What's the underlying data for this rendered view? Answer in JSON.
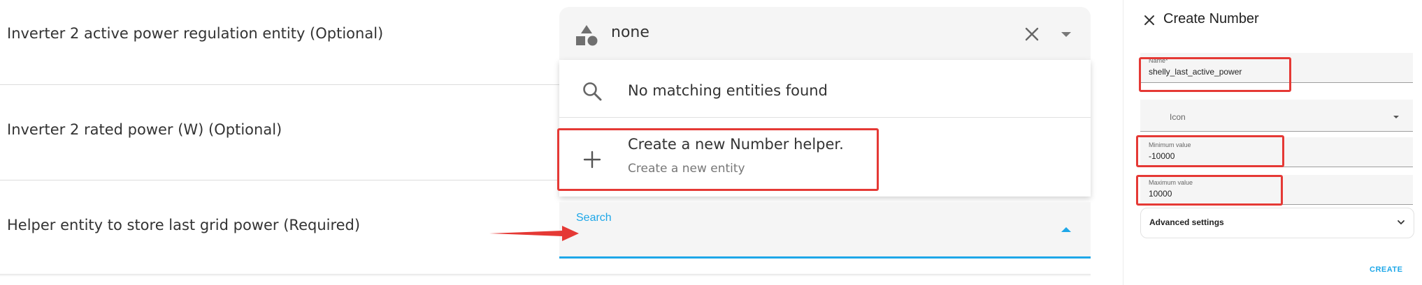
{
  "form": {
    "rows": [
      {
        "label": "Inverter 2 active power regulation entity (Optional)"
      },
      {
        "label": "Inverter 2 rated power (W) (Optional)"
      },
      {
        "label": "Helper entity to store last grid power (Required)"
      }
    ]
  },
  "entity_select": {
    "value": "none",
    "icon": "shapes-icon"
  },
  "dropdown": {
    "no_match_text": "No matching entities found",
    "create_primary": "Create a new Number helper.",
    "create_secondary": "Create a new entity"
  },
  "search_field": {
    "label": "Search"
  },
  "dialog": {
    "title": "Create Number",
    "fields": {
      "name": {
        "label": "Name*",
        "value": "shelly_last_active_power"
      },
      "icon": {
        "placeholder": "Icon"
      },
      "min": {
        "label": "Minimum value",
        "value": "-10000"
      },
      "max": {
        "label": "Maximum value",
        "value": "10000"
      }
    },
    "advanced_label": "Advanced settings",
    "create_button": "CREATE"
  },
  "colors": {
    "accent": "#1ea7e8",
    "highlight": "#e53935"
  }
}
